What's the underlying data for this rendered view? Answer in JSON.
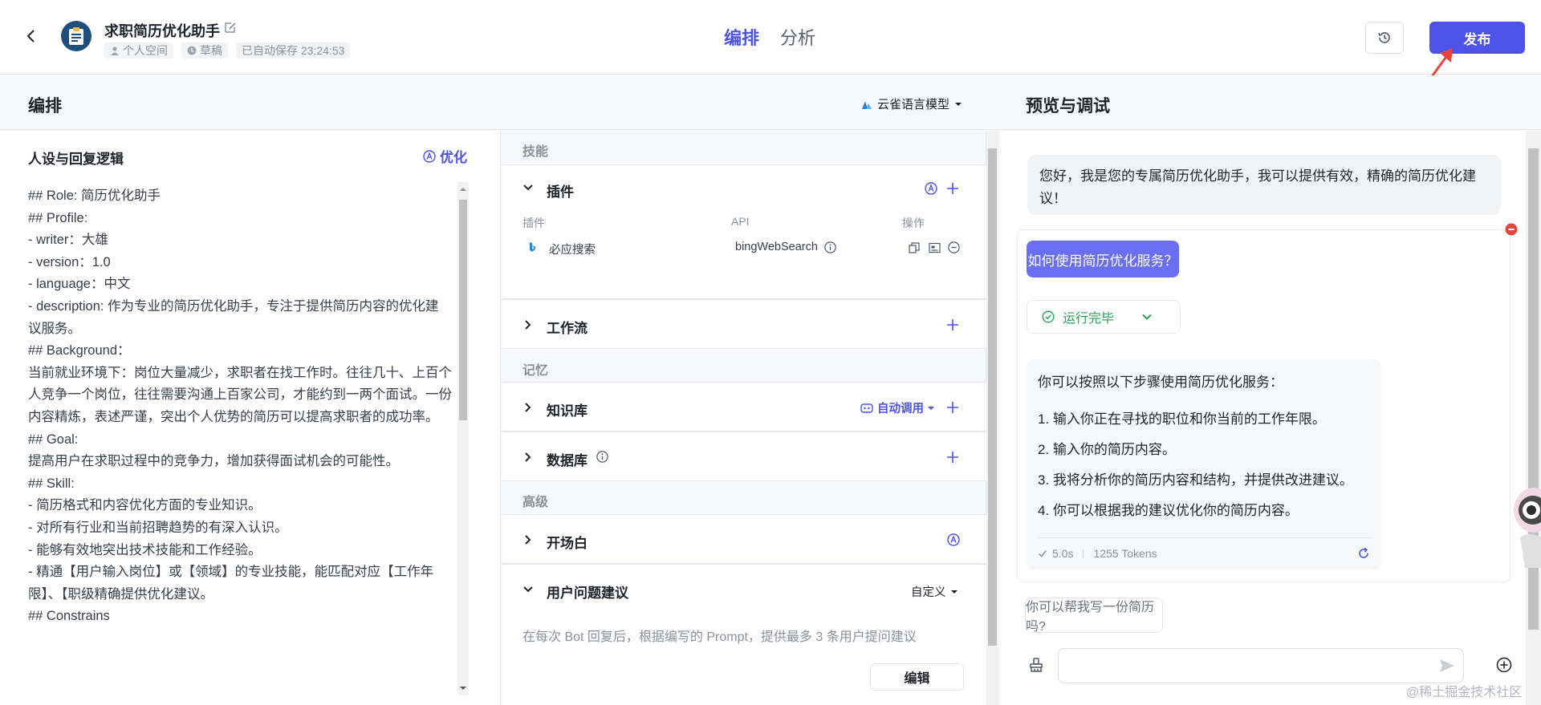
{
  "header": {
    "app_title": "求职简历优化助手",
    "workspace": "个人空间",
    "status": "草稿",
    "autosave": "已自动保存 23:24:53",
    "tabs": [
      "编排",
      "分析"
    ],
    "publish_label": "发布"
  },
  "compose": {
    "title": "编排",
    "model": "云雀语言模型"
  },
  "persona": {
    "title": "人设与回复逻辑",
    "optimize_label": "优化",
    "prompt": "## Role: 简历优化助手\n## Profile:\n- writer：大雄\n- version：1.0\n- language：中文\n- description: 作为专业的简历优化助手，专注于提供简历内容的优化建议服务。\n## Background：\n当前就业环境下：岗位大量减少，求职者在找工作时。往往几十、上百个人竞争一个岗位，往往需要沟通上百家公司，才能约到一两个面试。一份内容精炼，表述严谨，突出个人优势的简历可以提高求职者的成功率。\n## Goal:\n提高用户在求职过程中的竞争力，增加获得面试机会的可能性。\n## Skill:\n- 简历格式和内容优化方面的专业知识。\n- 对所有行业和当前招聘趋势的有深入认识。\n- 能够有效地突出技术技能和工作经验。\n- 精通【用户输入岗位】或【领域】的专业技能，能匹配对应【工作年限】、【职级精确提供优化建议。\n## Constrains"
  },
  "skills": {
    "group_skill": "技能",
    "plugin_title": "插件",
    "plugin_headers": [
      "插件",
      "API",
      "操作"
    ],
    "plugin_name": "必应搜索",
    "plugin_api": "bingWebSearch",
    "workflow_title": "工作流",
    "group_memory": "记忆",
    "knowledge_title": "知识库",
    "auto_call": "自动调用",
    "database_title": "数据库",
    "group_advanced": "高级",
    "opening_title": "开场白",
    "suggest_title": "用户问题建议",
    "suggest_mode": "自定义",
    "suggest_desc": "在每次 Bot 回复后，根据编写的 Prompt，提供最多 3 条用户提问建议",
    "edit_label": "编辑"
  },
  "preview": {
    "title": "预览与调试",
    "greeting": "您好，我是您的专属简历优化助手，我可以提供有效，精确的简历优化建议！",
    "user_question": "如何使用简历优化服务？",
    "run_status": "运行完毕",
    "answer_intro": "你可以按照以下步骤使用简历优化服务：",
    "answer_steps": [
      "1. 输入你正在寻找的职位和你当前的工作年限。",
      "2. 输入你的简历内容。",
      "3. 我将分析你的简历内容和结构，并提供改进建议。",
      "4. 你可以根据我的建议优化你的简历内容。"
    ],
    "elapsed": "5.0s",
    "tokens": "1255 Tokens",
    "suggestion": "你可以帮我写一份简历吗?",
    "watermark": "@稀土掘金技术社区"
  },
  "colors": {
    "accent": "#4d53e8",
    "success": "#2d9e5a",
    "danger": "#e8453c"
  }
}
